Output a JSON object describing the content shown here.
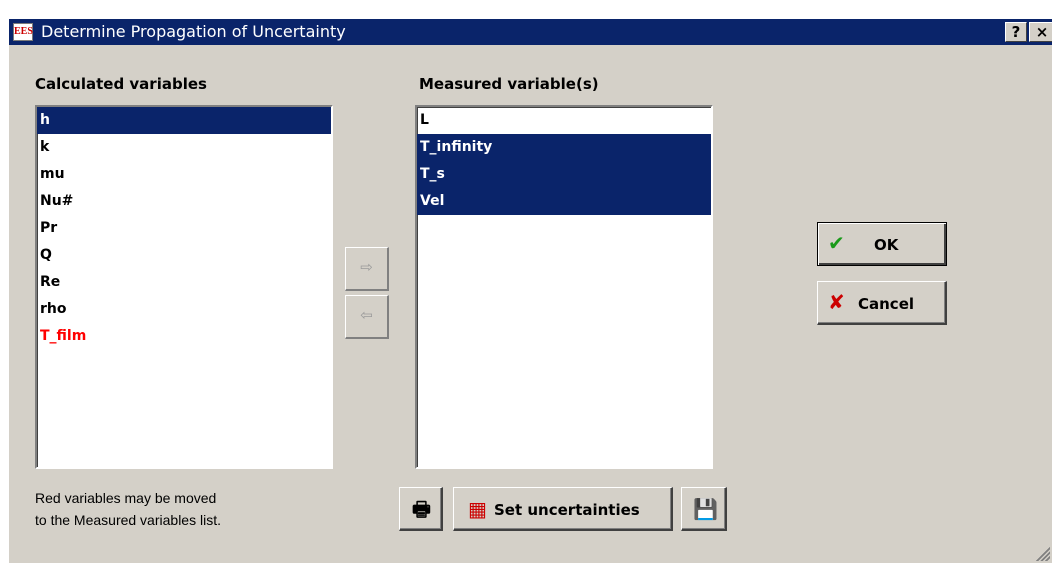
{
  "window": {
    "title": "Determine Propagation of Uncertainty",
    "icon": "EES",
    "help_label": "?",
    "close_label": "×"
  },
  "calculated": {
    "label": "Calculated variables",
    "items": [
      {
        "text": "h",
        "selected": true,
        "movable": false
      },
      {
        "text": "k",
        "selected": false,
        "movable": false
      },
      {
        "text": "mu",
        "selected": false,
        "movable": false
      },
      {
        "text": "Nu#",
        "selected": false,
        "movable": false
      },
      {
        "text": "Pr",
        "selected": false,
        "movable": false
      },
      {
        "text": "Q",
        "selected": false,
        "movable": false
      },
      {
        "text": "Re",
        "selected": false,
        "movable": false
      },
      {
        "text": "rho",
        "selected": false,
        "movable": false
      },
      {
        "text": "T_film",
        "selected": false,
        "movable": true
      }
    ]
  },
  "measured": {
    "label": "Measured variable(s)",
    "items": [
      {
        "text": "L",
        "selected": false
      },
      {
        "text": "T_infinity",
        "selected": true
      },
      {
        "text": "T_s",
        "selected": true
      },
      {
        "text": "Vel",
        "selected": true
      }
    ]
  },
  "move": {
    "right_glyph": "⇨",
    "left_glyph": "⇦"
  },
  "buttons": {
    "ok": "OK",
    "ok_icon": "✔",
    "cancel": "Cancel",
    "cancel_icon": "✘",
    "set_uncertainties": "Set uncertainties",
    "print_icon": "🖶",
    "chart_icon": "▦",
    "save_icon": "💾"
  },
  "hint": {
    "line1": "Red variables may be moved",
    "line2": "to the Measured variables list."
  },
  "colors": {
    "titlebar": "#0a246a",
    "selection": "#0a246a",
    "movable_text": "#ff0000",
    "face": "#d4d0c8"
  }
}
